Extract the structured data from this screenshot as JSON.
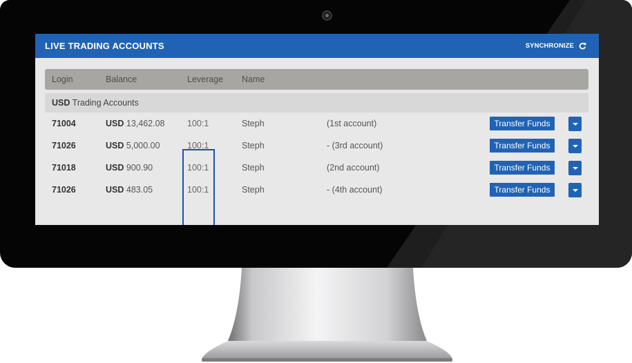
{
  "app": {
    "title": "LIVE TRADING ACCOUNTS",
    "sync_label": "SYNCHRONIZE",
    "sync_icon": "refresh-icon",
    "accent_color": "#2063b5"
  },
  "table": {
    "columns": [
      "Login",
      "Balance",
      "Leverage",
      "Name"
    ],
    "group": {
      "currency": "USD",
      "label": "Trading Accounts"
    },
    "rows": [
      {
        "login": "71004",
        "currency": "USD",
        "balance": "13,462.08",
        "leverage": "100:1",
        "name": "Steph",
        "note": "(1st account)",
        "action": "Transfer Funds"
      },
      {
        "login": "71026",
        "currency": "USD",
        "balance": "5,000.00",
        "leverage": "100:1",
        "name": "Steph",
        "note": "- (3rd account)",
        "action": "Transfer Funds"
      },
      {
        "login": "71018",
        "currency": "USD",
        "balance": "900.90",
        "leverage": "100:1",
        "name": "Steph",
        "note": "(2nd account)",
        "action": "Transfer Funds"
      },
      {
        "login": "71026",
        "currency": "USD",
        "balance": "483.05",
        "leverage": "100:1",
        "name": "Steph",
        "note": "- (4th account)",
        "action": "Transfer Funds"
      }
    ]
  },
  "icons": {
    "dropdown": "chevron-down-icon",
    "camera": "webcam-icon"
  }
}
